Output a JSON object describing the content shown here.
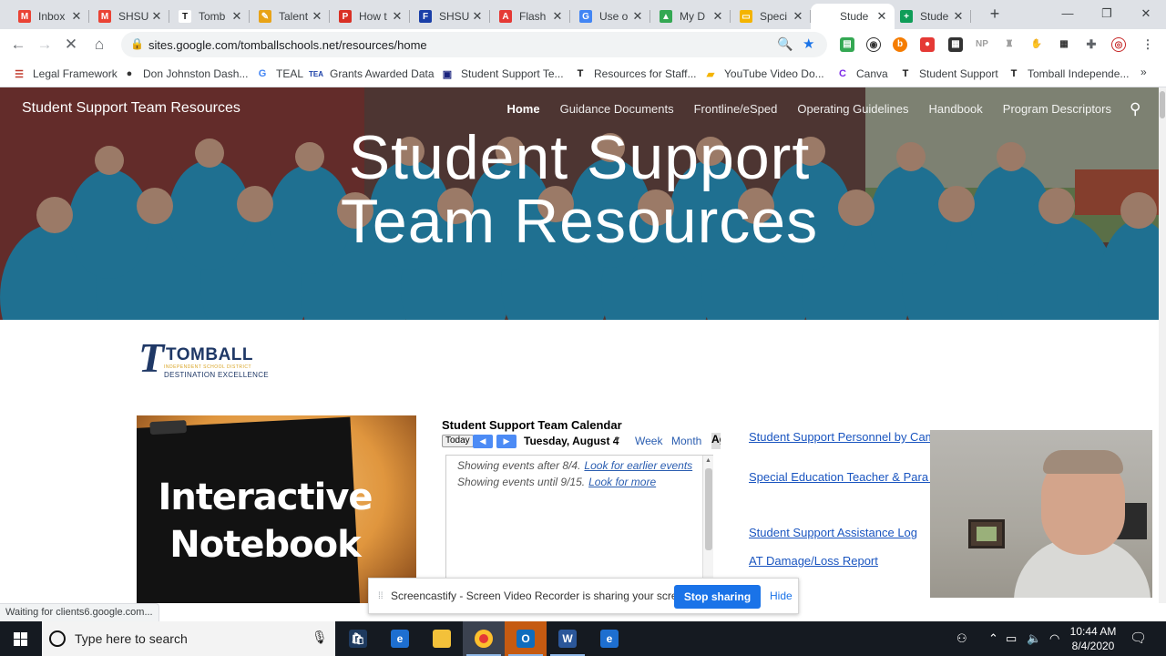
{
  "tabs": [
    {
      "title": "Inbox",
      "fav_letter": "M",
      "fav_color": "#ea4335"
    },
    {
      "title": "SHSU",
      "fav_letter": "M",
      "fav_color": "#ea4335"
    },
    {
      "title": "Tomb",
      "fav_letter": "T",
      "fav_color": "#111111"
    },
    {
      "title": "Talent",
      "fav_letter": "✎",
      "fav_color": "#e8a317"
    },
    {
      "title": "How t",
      "fav_letter": "P",
      "fav_color": "#d93025"
    },
    {
      "title": "SHSU",
      "fav_letter": "F",
      "fav_color": "#1a3fa8"
    },
    {
      "title": "Flash",
      "fav_letter": "A",
      "fav_color": "#e53935"
    },
    {
      "title": "Use o",
      "fav_letter": "G",
      "fav_color": "#4285f4"
    },
    {
      "title": "My D",
      "fav_letter": "▲",
      "fav_color": "#34a853"
    },
    {
      "title": "Speci",
      "fav_letter": "▭",
      "fav_color": "#f4b400"
    },
    {
      "title": "Stude",
      "fav_letter": "·",
      "fav_color": "#ffffff",
      "active": true
    },
    {
      "title": "Stude",
      "fav_letter": "+",
      "fav_color": "#0f9d58"
    }
  ],
  "toolbar": {
    "url": "sites.google.com/tomballschools.net/resources/home"
  },
  "bookmarks": [
    {
      "label": "Legal Framework",
      "icon": "☰",
      "icon_color": "#c0392b"
    },
    {
      "label": "Don Johnston Dash...",
      "icon": "●",
      "icon_color": "#333333"
    },
    {
      "label": "TEAL",
      "icon": "G",
      "icon_color": "#4285f4"
    },
    {
      "label": "Grants Awarded Data",
      "icon": "TEA",
      "icon_color": "#1a3fa8"
    },
    {
      "label": "Student Support Te...",
      "icon": "▣",
      "icon_color": "#1a237e"
    },
    {
      "label": "Resources for Staff...",
      "icon": "T",
      "icon_color": "#111111"
    },
    {
      "label": "YouTube Video Do...",
      "icon": "▰",
      "icon_color": "#f4b400"
    },
    {
      "label": "Canva",
      "icon": "C",
      "icon_color": "#7d2ae8"
    },
    {
      "label": "Student Support",
      "icon": "T",
      "icon_color": "#111111"
    },
    {
      "label": "Tomball Independe...",
      "icon": "T",
      "icon_color": "#111111"
    }
  ],
  "site": {
    "title": "Student Support Team Resources",
    "nav": [
      "Home",
      "Guidance Documents",
      "Frontline/eSped",
      "Operating Guidelines",
      "Handbook",
      "Program Descriptors"
    ],
    "hero_line1": "Student Support",
    "hero_line2": "Team Resources"
  },
  "logo": {
    "big": "T",
    "word": "TOMBALL",
    "sub1": "INDEPENDENT SCHOOL DISTRICT",
    "sub2": "DESTINATION EXCELLENCE"
  },
  "notebook": {
    "line1": "Interactive",
    "line2": "Notebook"
  },
  "calendar": {
    "title": "Student Support Team Calendar",
    "today": "Today",
    "date": "Tuesday, August 4",
    "week": "Week",
    "month": "Month",
    "agenda": "Ag",
    "line1_text": "Showing events after 8/4.",
    "line1_link": "Look for earlier events",
    "line2_text": "Showing events until 9/15.",
    "line2_link": "Look for more"
  },
  "links": [
    "Student Support Personnel by Campus",
    "Special Education Teacher & Para List",
    "Student Support Assistance Log",
    "AT Damage/Loss Report"
  ],
  "screencast": {
    "message": "Screencastify - Screen Video Recorder is sharing your screen.",
    "stop": "Stop sharing",
    "hide": "Hide"
  },
  "status": "Waiting for clients6.google.com...",
  "taskbar": {
    "search_placeholder": "Type here to search",
    "time": "10:44 AM",
    "date": "8/4/2020"
  }
}
